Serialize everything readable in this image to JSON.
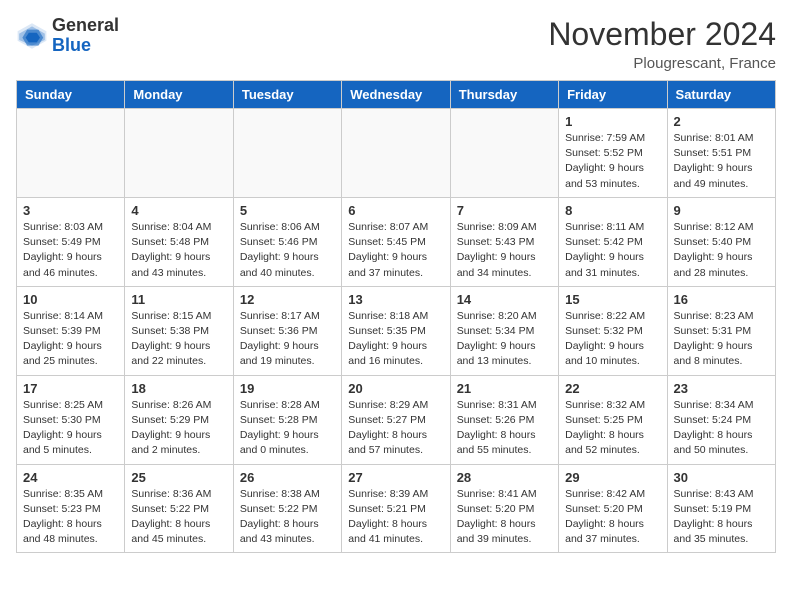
{
  "header": {
    "logo_line1": "General",
    "logo_line2": "Blue",
    "month": "November 2024",
    "location": "Plougrescant, France"
  },
  "days_of_week": [
    "Sunday",
    "Monday",
    "Tuesday",
    "Wednesday",
    "Thursday",
    "Friday",
    "Saturday"
  ],
  "weeks": [
    [
      {
        "day": "",
        "info": ""
      },
      {
        "day": "",
        "info": ""
      },
      {
        "day": "",
        "info": ""
      },
      {
        "day": "",
        "info": ""
      },
      {
        "day": "",
        "info": ""
      },
      {
        "day": "1",
        "info": "Sunrise: 7:59 AM\nSunset: 5:52 PM\nDaylight: 9 hours\nand 53 minutes."
      },
      {
        "day": "2",
        "info": "Sunrise: 8:01 AM\nSunset: 5:51 PM\nDaylight: 9 hours\nand 49 minutes."
      }
    ],
    [
      {
        "day": "3",
        "info": "Sunrise: 8:03 AM\nSunset: 5:49 PM\nDaylight: 9 hours\nand 46 minutes."
      },
      {
        "day": "4",
        "info": "Sunrise: 8:04 AM\nSunset: 5:48 PM\nDaylight: 9 hours\nand 43 minutes."
      },
      {
        "day": "5",
        "info": "Sunrise: 8:06 AM\nSunset: 5:46 PM\nDaylight: 9 hours\nand 40 minutes."
      },
      {
        "day": "6",
        "info": "Sunrise: 8:07 AM\nSunset: 5:45 PM\nDaylight: 9 hours\nand 37 minutes."
      },
      {
        "day": "7",
        "info": "Sunrise: 8:09 AM\nSunset: 5:43 PM\nDaylight: 9 hours\nand 34 minutes."
      },
      {
        "day": "8",
        "info": "Sunrise: 8:11 AM\nSunset: 5:42 PM\nDaylight: 9 hours\nand 31 minutes."
      },
      {
        "day": "9",
        "info": "Sunrise: 8:12 AM\nSunset: 5:40 PM\nDaylight: 9 hours\nand 28 minutes."
      }
    ],
    [
      {
        "day": "10",
        "info": "Sunrise: 8:14 AM\nSunset: 5:39 PM\nDaylight: 9 hours\nand 25 minutes."
      },
      {
        "day": "11",
        "info": "Sunrise: 8:15 AM\nSunset: 5:38 PM\nDaylight: 9 hours\nand 22 minutes."
      },
      {
        "day": "12",
        "info": "Sunrise: 8:17 AM\nSunset: 5:36 PM\nDaylight: 9 hours\nand 19 minutes."
      },
      {
        "day": "13",
        "info": "Sunrise: 8:18 AM\nSunset: 5:35 PM\nDaylight: 9 hours\nand 16 minutes."
      },
      {
        "day": "14",
        "info": "Sunrise: 8:20 AM\nSunset: 5:34 PM\nDaylight: 9 hours\nand 13 minutes."
      },
      {
        "day": "15",
        "info": "Sunrise: 8:22 AM\nSunset: 5:32 PM\nDaylight: 9 hours\nand 10 minutes."
      },
      {
        "day": "16",
        "info": "Sunrise: 8:23 AM\nSunset: 5:31 PM\nDaylight: 9 hours\nand 8 minutes."
      }
    ],
    [
      {
        "day": "17",
        "info": "Sunrise: 8:25 AM\nSunset: 5:30 PM\nDaylight: 9 hours\nand 5 minutes."
      },
      {
        "day": "18",
        "info": "Sunrise: 8:26 AM\nSunset: 5:29 PM\nDaylight: 9 hours\nand 2 minutes."
      },
      {
        "day": "19",
        "info": "Sunrise: 8:28 AM\nSunset: 5:28 PM\nDaylight: 9 hours\nand 0 minutes."
      },
      {
        "day": "20",
        "info": "Sunrise: 8:29 AM\nSunset: 5:27 PM\nDaylight: 8 hours\nand 57 minutes."
      },
      {
        "day": "21",
        "info": "Sunrise: 8:31 AM\nSunset: 5:26 PM\nDaylight: 8 hours\nand 55 minutes."
      },
      {
        "day": "22",
        "info": "Sunrise: 8:32 AM\nSunset: 5:25 PM\nDaylight: 8 hours\nand 52 minutes."
      },
      {
        "day": "23",
        "info": "Sunrise: 8:34 AM\nSunset: 5:24 PM\nDaylight: 8 hours\nand 50 minutes."
      }
    ],
    [
      {
        "day": "24",
        "info": "Sunrise: 8:35 AM\nSunset: 5:23 PM\nDaylight: 8 hours\nand 48 minutes."
      },
      {
        "day": "25",
        "info": "Sunrise: 8:36 AM\nSunset: 5:22 PM\nDaylight: 8 hours\nand 45 minutes."
      },
      {
        "day": "26",
        "info": "Sunrise: 8:38 AM\nSunset: 5:22 PM\nDaylight: 8 hours\nand 43 minutes."
      },
      {
        "day": "27",
        "info": "Sunrise: 8:39 AM\nSunset: 5:21 PM\nDaylight: 8 hours\nand 41 minutes."
      },
      {
        "day": "28",
        "info": "Sunrise: 8:41 AM\nSunset: 5:20 PM\nDaylight: 8 hours\nand 39 minutes."
      },
      {
        "day": "29",
        "info": "Sunrise: 8:42 AM\nSunset: 5:20 PM\nDaylight: 8 hours\nand 37 minutes."
      },
      {
        "day": "30",
        "info": "Sunrise: 8:43 AM\nSunset: 5:19 PM\nDaylight: 8 hours\nand 35 minutes."
      }
    ]
  ]
}
